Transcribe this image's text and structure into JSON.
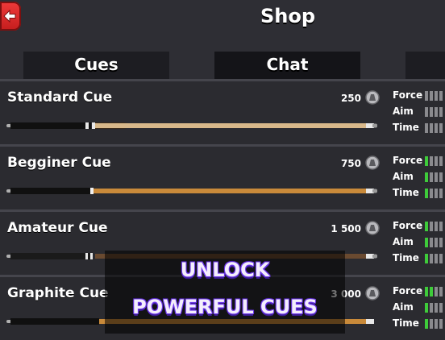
{
  "header": {
    "title": "Shop"
  },
  "tabs": [
    {
      "label": "Cues",
      "active": false
    },
    {
      "label": "Chat",
      "active": true
    },
    {
      "label": "",
      "active": false
    }
  ],
  "stat_labels": {
    "force": "Force",
    "aim": "Aim",
    "time": "Time"
  },
  "cues": [
    {
      "name": "Standard Cue",
      "price": "250",
      "force": 0,
      "aim": 0,
      "time": 0
    },
    {
      "name": "Begginer Cue",
      "price": "750",
      "force": 1,
      "aim": 1,
      "time": 1
    },
    {
      "name": "Amateur Cue",
      "price": "1 500",
      "force": 1,
      "aim": 1,
      "time": 1
    },
    {
      "name": "Graphite Cue",
      "price": "3 000",
      "force": 2,
      "aim": 1,
      "time": 1
    }
  ],
  "promo": {
    "line1": "UNLOCK",
    "line2": "POWERFUL CUES"
  },
  "colors": {
    "back_button": "#e02828",
    "stat_on": "#3ecb3a",
    "stat_off": "#8a8a8e",
    "promo_text_outline": "#6b36e8"
  },
  "icons": {
    "back": "arrow-left-icon",
    "price": "coin-icon"
  }
}
